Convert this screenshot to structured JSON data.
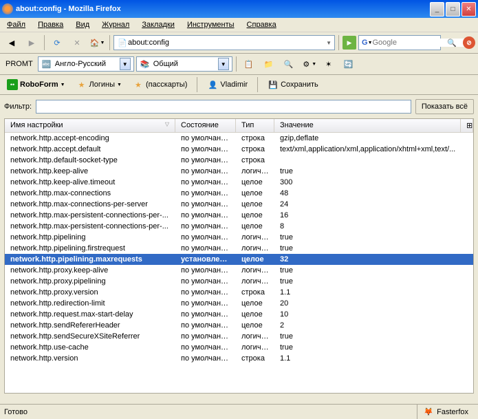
{
  "window": {
    "title": "about:config - Mozilla Firefox"
  },
  "menu": [
    "Файл",
    "Правка",
    "Вид",
    "Журнал",
    "Закладки",
    "Инструменты",
    "Справка"
  ],
  "url": "about:config",
  "search_placeholder": "Google",
  "promt": {
    "label": "PROMT",
    "lang": "Англо-Русский",
    "dict": "Общий"
  },
  "robo": {
    "form": "RoboForm",
    "logins": "Логины",
    "passcards": "(пасскарты)",
    "user": "Vladimir",
    "save": "Сохранить"
  },
  "filter": {
    "label": "Фильтр:",
    "value": "",
    "show_all": "Показать всё"
  },
  "columns": [
    "Имя настройки",
    "Состояние",
    "Тип",
    "Значение"
  ],
  "rows": [
    {
      "n": "network.http.accept-encoding",
      "s": "по умолчанию",
      "t": "строка",
      "v": "gzip,deflate",
      "sel": false
    },
    {
      "n": "network.http.accept.default",
      "s": "по умолчанию",
      "t": "строка",
      "v": "text/xml,application/xml,application/xhtml+xml,text/...",
      "sel": false
    },
    {
      "n": "network.http.default-socket-type",
      "s": "по умолчанию",
      "t": "строка",
      "v": "",
      "sel": false
    },
    {
      "n": "network.http.keep-alive",
      "s": "по умолчанию",
      "t": "логиче...",
      "v": "true",
      "sel": false
    },
    {
      "n": "network.http.keep-alive.timeout",
      "s": "по умолчанию",
      "t": "целое",
      "v": "300",
      "sel": false
    },
    {
      "n": "network.http.max-connections",
      "s": "по умолчанию",
      "t": "целое",
      "v": "48",
      "sel": false
    },
    {
      "n": "network.http.max-connections-per-server",
      "s": "по умолчанию",
      "t": "целое",
      "v": "24",
      "sel": false
    },
    {
      "n": "network.http.max-persistent-connections-per-...",
      "s": "по умолчанию",
      "t": "целое",
      "v": "16",
      "sel": false
    },
    {
      "n": "network.http.max-persistent-connections-per-...",
      "s": "по умолчанию",
      "t": "целое",
      "v": "8",
      "sel": false
    },
    {
      "n": "network.http.pipelining",
      "s": "по умолчанию",
      "t": "логиче...",
      "v": "true",
      "sel": false
    },
    {
      "n": "network.http.pipelining.firstrequest",
      "s": "по умолчанию",
      "t": "логиче...",
      "v": "true",
      "sel": false
    },
    {
      "n": "network.http.pipelining.maxrequests",
      "s": "установлен...",
      "t": "целое",
      "v": "32",
      "sel": true
    },
    {
      "n": "network.http.proxy.keep-alive",
      "s": "по умолчанию",
      "t": "логиче...",
      "v": "true",
      "sel": false
    },
    {
      "n": "network.http.proxy.pipelining",
      "s": "по умолчанию",
      "t": "логиче...",
      "v": "true",
      "sel": false
    },
    {
      "n": "network.http.proxy.version",
      "s": "по умолчанию",
      "t": "строка",
      "v": "1.1",
      "sel": false
    },
    {
      "n": "network.http.redirection-limit",
      "s": "по умолчанию",
      "t": "целое",
      "v": "20",
      "sel": false
    },
    {
      "n": "network.http.request.max-start-delay",
      "s": "по умолчанию",
      "t": "целое",
      "v": "10",
      "sel": false
    },
    {
      "n": "network.http.sendRefererHeader",
      "s": "по умолчанию",
      "t": "целое",
      "v": "2",
      "sel": false
    },
    {
      "n": "network.http.sendSecureXSiteReferrer",
      "s": "по умолчанию",
      "t": "логиче...",
      "v": "true",
      "sel": false
    },
    {
      "n": "network.http.use-cache",
      "s": "по умолчанию",
      "t": "логиче...",
      "v": "true",
      "sel": false
    },
    {
      "n": "network.http.version",
      "s": "по умолчанию",
      "t": "строка",
      "v": "1.1",
      "sel": false
    }
  ],
  "status": {
    "ready": "Готово",
    "fasterfox": "Fasterfox"
  }
}
